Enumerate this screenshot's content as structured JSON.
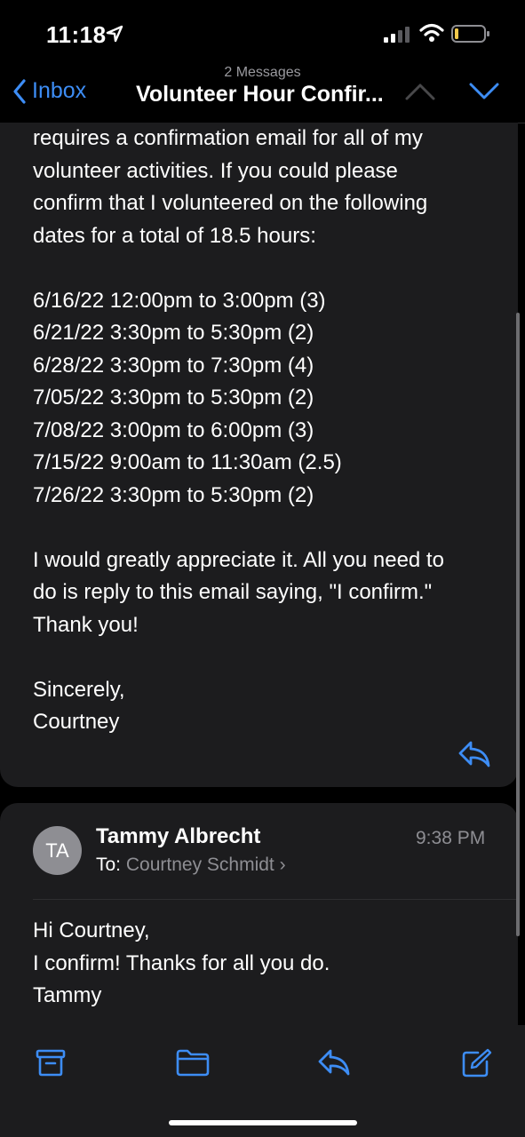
{
  "status_bar": {
    "time": "11:18",
    "icons": [
      "location-arrow-icon",
      "cellular-signal-icon",
      "wifi-icon",
      "battery-low-icon"
    ]
  },
  "nav": {
    "back_label": "Inbox",
    "message_count": "2 Messages",
    "subject": "Volunteer Hour Confir...",
    "icons": [
      "chevron-left-icon",
      "chevron-up-icon",
      "chevron-down-icon"
    ]
  },
  "first_message": {
    "intro_lines": [
      "requires a confirmation email for all of my",
      "volunteer activities. If you could please",
      "confirm that I volunteered on the following",
      "dates for a total of 18.5 hours:"
    ],
    "dates": [
      "6/16/22 12:00pm to 3:00pm (3)",
      "6/21/22 3:30pm to 5:30pm (2)",
      "6/28/22 3:30pm to 7:30pm (4)",
      "7/05/22 3:30pm to 5:30pm (2)",
      "7/08/22 3:00pm to 6:00pm (3)",
      "7/15/22 9:00am to 11:30am (2.5)",
      "7/26/22 3:30pm to 5:30pm (2)"
    ],
    "closing_lines": [
      "I would greatly appreciate it. All you need to",
      "do is reply to this email saying, \"I confirm.\"",
      "Thank you!"
    ],
    "signoff_lines": [
      "Sincerely,",
      "Courtney"
    ]
  },
  "second_message": {
    "avatar_initials": "TA",
    "sender": "Tammy Albrecht",
    "time": "9:38 PM",
    "to_label": "To:",
    "recipient": "Courtney Schmidt",
    "chevron": "›",
    "body_lines": [
      "Hi Courtney,",
      "I confirm!  Thanks for all you do.",
      "Tammy"
    ]
  },
  "toolbar": {
    "icons": [
      "archive-icon",
      "folder-icon",
      "reply-icon",
      "compose-icon"
    ]
  },
  "colors": {
    "accent": "#3d8df5",
    "background": "#000000",
    "card": "#1c1c1e",
    "secondary_text": "#8e8e93"
  }
}
